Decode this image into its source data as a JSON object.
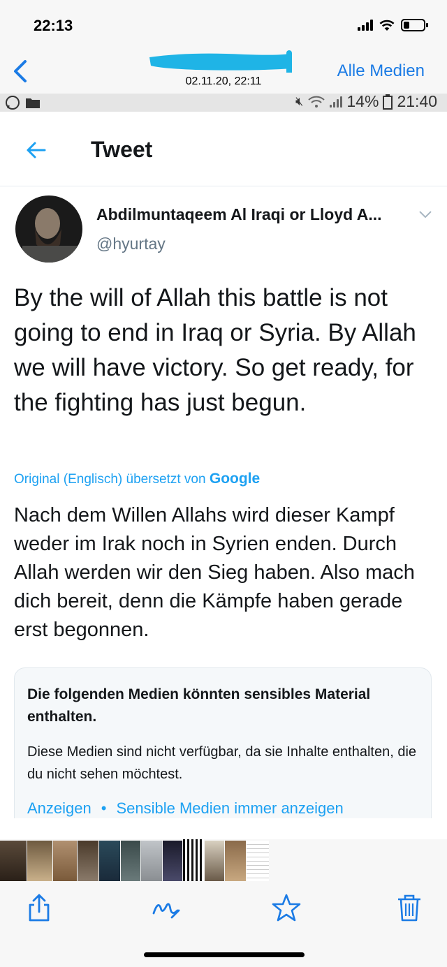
{
  "status_bar": {
    "time": "22:13",
    "battery_level": 0.3
  },
  "header": {
    "back_icon": "chevron-left-icon",
    "date": "02.11.20, 22:11",
    "right_button": "Alle Medien",
    "accent_color": "#1b7be5"
  },
  "screenshot": {
    "android_status": {
      "battery": "14%",
      "time": "21:40"
    },
    "tweet_header": {
      "title": "Tweet",
      "back_icon": "arrow-left-icon"
    },
    "author": {
      "name": "Abdilmuntaqeem Al Iraqi or Lloyd A...",
      "handle": "@hyurtay"
    },
    "tweet_text": "By the will of Allah this battle is not going to end in Iraq or Syria. By Allah we will have victory. So get ready, for the fighting has just begun.",
    "translation": {
      "label": "Original (Englisch) übersetzt von",
      "provider": "Google",
      "text": "Nach dem Willen Allahs wird dieser Kampf weder im Irak noch in Syrien enden. Durch Allah werden wir den Sieg haben. Also mach dich bereit, denn die Kämpfe haben gerade erst begonnen."
    },
    "sensitive_media": {
      "title": "Die folgenden Medien könnten sensibles Material enthalten.",
      "body": "Diese Medien sind nicht verfügbar, da sie Inhalte enthalten, die du nicht sehen möchtest.",
      "show_link": "Anzeigen",
      "separator": "•",
      "always_link": "Sensible Medien immer anzeigen"
    },
    "twitter_blue": "#1da1f2"
  },
  "toolbar": {
    "icons": [
      "share-icon",
      "markup-icon",
      "favorite-icon",
      "trash-icon"
    ]
  }
}
